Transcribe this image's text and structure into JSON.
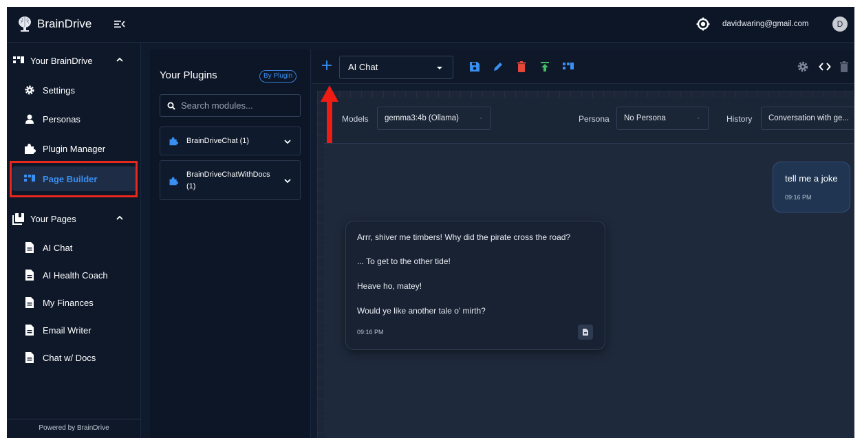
{
  "app": {
    "brand": "BrainDrive"
  },
  "header": {
    "email": "davidwaring@gmail.com",
    "avatar_initial": "D"
  },
  "sidebar": {
    "section1": "Your BrainDrive",
    "items1": [
      "Settings",
      "Personas",
      "Plugin Manager",
      "Page Builder"
    ],
    "section2": "Your Pages",
    "items2": [
      "AI Chat",
      "AI Health Coach",
      "My Finances",
      "Email Writer",
      "Chat w/ Docs"
    ],
    "footer": "Powered by BrainDrive",
    "active_item": "Page Builder"
  },
  "plugins": {
    "title": "Your Plugins",
    "view_toggle": "By Plugin",
    "search_placeholder": "Search modules...",
    "list": [
      {
        "name_line1": "BrainDriveChat (1)",
        "name_line2": ""
      },
      {
        "name_line1": "BrainDriveChatWithDocs",
        "name_line2": "(1)"
      }
    ]
  },
  "toolbar": {
    "current_page": "AI Chat",
    "icons": [
      "add-icon",
      "save-icon",
      "edit-icon",
      "delete-icon",
      "publish-icon",
      "route-icon",
      "settings-icon",
      "code-icon",
      "trash-icon"
    ]
  },
  "chat": {
    "models_label": "Models",
    "model_value": "gemma3:4b (Ollama)",
    "persona_label": "Persona",
    "persona_value": "No Persona",
    "history_label": "History",
    "history_value": "Conversation with ge...",
    "user_message": {
      "text": "tell me a joke",
      "time": "09:16 PM"
    },
    "bot_message": {
      "lines": [
        "Arrr, shiver me timbers! Why did the pirate cross the road?",
        "... To get to the other tide!",
        "Heave ho, matey!",
        "Would ye like another tale o' mirth?"
      ],
      "time": "09:16 PM"
    }
  },
  "colors": {
    "accent": "#3a8ff2",
    "highlight": "#e8281c",
    "delete": "#e5483b",
    "publish": "#3fbf62"
  }
}
